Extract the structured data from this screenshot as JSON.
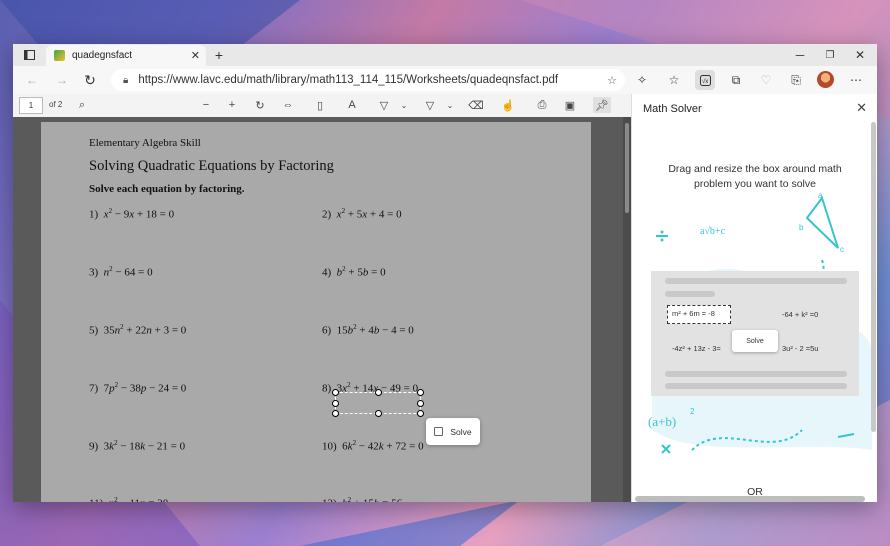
{
  "browser": {
    "tab_title": "quadegnsfact",
    "url": "https://www.lavc.edu/math/library/math113_114_115/Worksheets/quadeqnsfact.pdf"
  },
  "pdf_toolbar": {
    "page_current": "1",
    "page_total": "of 2"
  },
  "worksheet": {
    "header": "Elementary Algebra Skill",
    "title": "Solving Quadratic Equations by Factoring",
    "instruction": "Solve each equation by factoring."
  },
  "solve_popup": {
    "label": "Solve"
  },
  "math_solver": {
    "title": "Math Solver",
    "description": "Drag and resize the box around math problem you want to solve",
    "or_label": "OR",
    "demo": {
      "eq1": "m² + 6m = -8",
      "eq2": "-64 + k² =0",
      "eq3": "-4z² + 13z - 3=",
      "eq4": "3u² - 2  =5u",
      "solve_label": "Solve"
    }
  },
  "colors": {
    "accent": "#34c6cf",
    "pdf_bg": "#5a5a5a",
    "page_bg": "#a9a9a9"
  }
}
